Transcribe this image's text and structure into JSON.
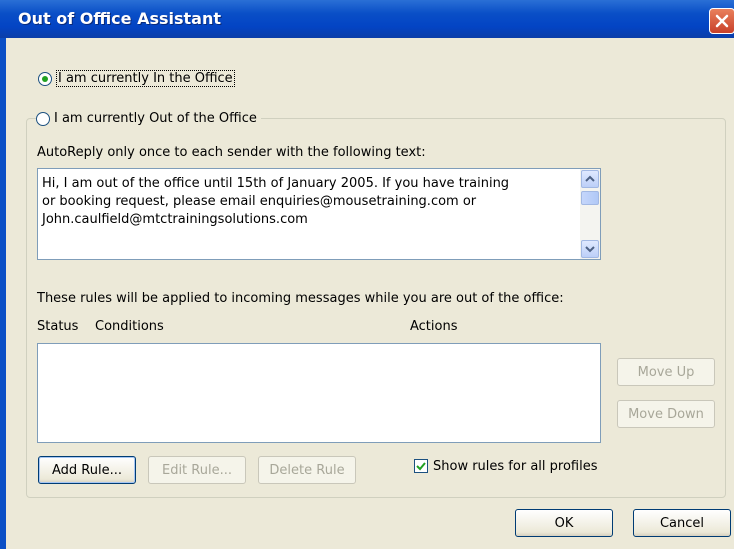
{
  "window": {
    "title": "Out of Office Assistant"
  },
  "status": {
    "in_office_label": "I am currently In the Office",
    "out_office_label": "I am currently Out of the Office",
    "selected": "in_office"
  },
  "autoreply": {
    "label": "AutoReply only once to each sender with the following text:",
    "lines": [
      "Hi, I am out of the office until 15th of January 2005. If you have training",
      "or booking request, please email enquiries@mousetraining.com or",
      "John.caulfield@mtctrainingsolutions.com"
    ]
  },
  "rules": {
    "description": "These rules will be applied to incoming messages while you are out of the office:",
    "columns": [
      "Status",
      "Conditions",
      "Actions"
    ],
    "move_up_label": "Move Up",
    "move_down_label": "Move Down",
    "add_rule_label": "Add Rule...",
    "edit_rule_label": "Edit Rule...",
    "delete_rule_label": "Delete Rule",
    "show_all_profiles_label": "Show rules for all profiles",
    "show_all_profiles_checked": true
  },
  "footer": {
    "ok_label": "OK",
    "cancel_label": "Cancel"
  },
  "colors": {
    "title_bar": "#0a4fc7",
    "dialog_bg": "#ece9d8",
    "radio_dot": "#21a121",
    "close_button": "#d4553a"
  }
}
